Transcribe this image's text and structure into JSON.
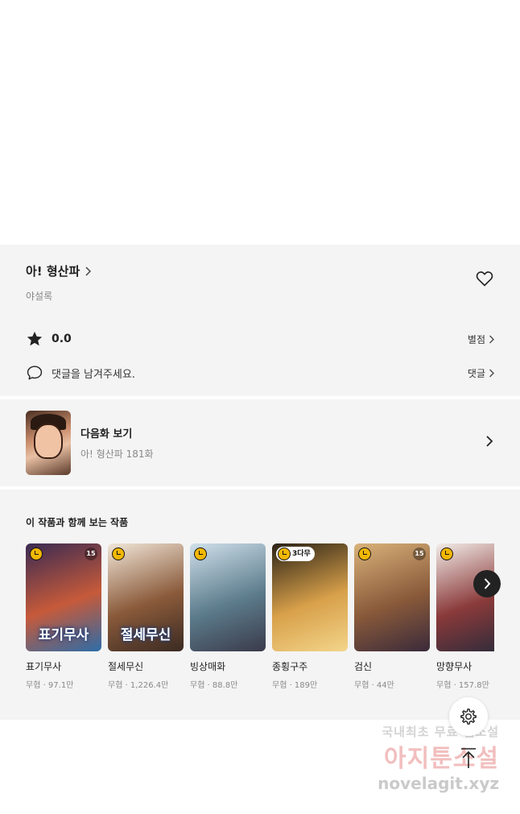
{
  "series": {
    "title": "아! 형산파",
    "author": "야설록"
  },
  "rating": {
    "value": "0.0",
    "link_label": "별점"
  },
  "comment": {
    "placeholder": "댓글을 남겨주세요.",
    "link_label": "댓글"
  },
  "next_episode": {
    "title": "다음화 보기",
    "subtitle": "아! 형산파 181화"
  },
  "recommendations": {
    "heading": "이 작품과 함께 보는 작품",
    "items": [
      {
        "name": "표기무사",
        "meta": "무협 · 97.1만",
        "badge": "",
        "age": "15",
        "logo": "표기무사",
        "colors": [
          "#3a2a52",
          "#c65a3a",
          "#2d6ca8"
        ]
      },
      {
        "name": "절세무신",
        "meta": "무협 · 1,226.4만",
        "badge": "",
        "age": "",
        "logo": "절세무신",
        "colors": [
          "#f1e6d8",
          "#8a5a3a",
          "#3a2a22"
        ]
      },
      {
        "name": "빙상매화",
        "meta": "무협 · 88.8만",
        "badge": "",
        "age": "",
        "logo": "",
        "colors": [
          "#cfe0ea",
          "#5c7c8c",
          "#3a3a4a"
        ]
      },
      {
        "name": "종횡구주",
        "meta": "무협 · 189만",
        "badge": "3다무",
        "age": "",
        "logo": "",
        "colors": [
          "#2a2216",
          "#d8a04a",
          "#f3d58a"
        ]
      },
      {
        "name": "검신",
        "meta": "무협 · 44만",
        "badge": "",
        "age": "15",
        "logo": "",
        "colors": [
          "#d9b27a",
          "#8a5a3a",
          "#3a2a3a"
        ]
      },
      {
        "name": "망향무사",
        "meta": "무협 · 157.8만",
        "badge": "",
        "age": "",
        "logo": "",
        "colors": [
          "#f2ece8",
          "#8a3a3a",
          "#2a2a3a"
        ]
      }
    ]
  },
  "watermark": {
    "line1": "국내최초 무료 웹소설",
    "line2": "아지툰소설",
    "line3": "novelagit.xyz"
  },
  "icons": {
    "heart": "heart-icon",
    "star": "star-icon",
    "comment": "comment-icon",
    "chevron": "chevron-right-icon",
    "gear": "gear-icon",
    "top": "scroll-top-icon"
  }
}
